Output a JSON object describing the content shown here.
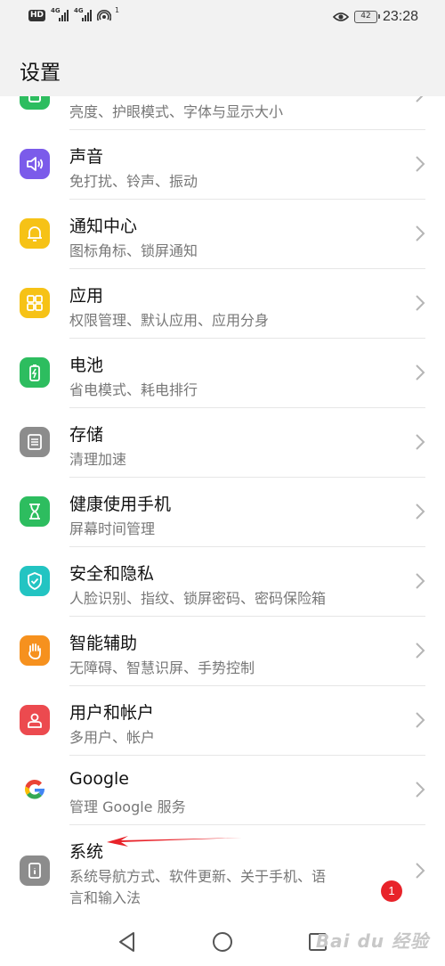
{
  "status_bar": {
    "hd": "HD",
    "signal1": "4G",
    "signal2": "4G",
    "wifi_count": "1",
    "battery": "42",
    "time": "23:28"
  },
  "header": {
    "title": "设置"
  },
  "items": [
    {
      "icon": "display-icon",
      "color": "#2dbd5f",
      "title": "",
      "sub": "亮度、护眼模式、字体与显示大小"
    },
    {
      "icon": "sound-icon",
      "color": "#7b5bea",
      "title": "声音",
      "sub": "免打扰、铃声、振动"
    },
    {
      "icon": "bell-icon",
      "color": "#f6c216",
      "title": "通知中心",
      "sub": "图标角标、锁屏通知"
    },
    {
      "icon": "apps-icon",
      "color": "#f6c216",
      "title": "应用",
      "sub": "权限管理、默认应用、应用分身"
    },
    {
      "icon": "battery-icon",
      "color": "#2dbd5f",
      "title": "电池",
      "sub": "省电模式、耗电排行"
    },
    {
      "icon": "storage-icon",
      "color": "#8c8c8c",
      "title": "存储",
      "sub": "清理加速"
    },
    {
      "icon": "hourglass-icon",
      "color": "#2dbd5f",
      "title": "健康使用手机",
      "sub": "屏幕时间管理"
    },
    {
      "icon": "shield-icon",
      "color": "#23c4c2",
      "title": "安全和隐私",
      "sub": "人脸识别、指纹、锁屏密码、密码保险箱"
    },
    {
      "icon": "hand-icon",
      "color": "#f6911e",
      "title": "智能辅助",
      "sub": "无障碍、智慧识屏、手势控制"
    },
    {
      "icon": "user-icon",
      "color": "#ec4a4f",
      "title": "用户和帐户",
      "sub": "多用户、帐户"
    },
    {
      "icon": "google-icon",
      "color": "#ffffff",
      "title": "Google",
      "sub": "管理 Google 服务"
    },
    {
      "icon": "info-icon",
      "color": "#8c8c8c",
      "title": "系统",
      "sub": "系统导航方式、软件更新、关于手机、语",
      "sub2": "言和输入法",
      "badge": "1"
    }
  ],
  "watermark": "Bai du 经验"
}
